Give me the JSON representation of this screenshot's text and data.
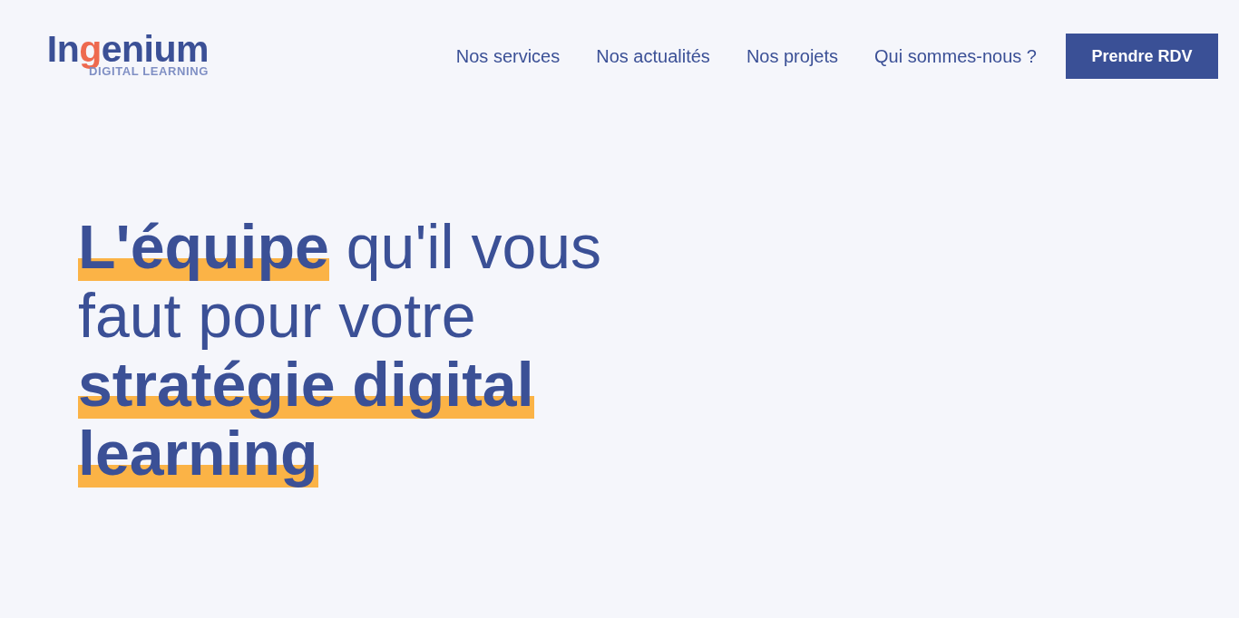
{
  "logo": {
    "name": "Ingenium",
    "tagline": "DIGITAL LEARNING"
  },
  "nav": {
    "links": [
      "Nos services",
      "Nos actualités",
      "Nos projets",
      "Qui sommes-nous ?"
    ],
    "cta": "Prendre RDV"
  },
  "hero": {
    "headline": "**L'équipe** qu'il vous faut pour votre **stratégie digital learning**"
  }
}
